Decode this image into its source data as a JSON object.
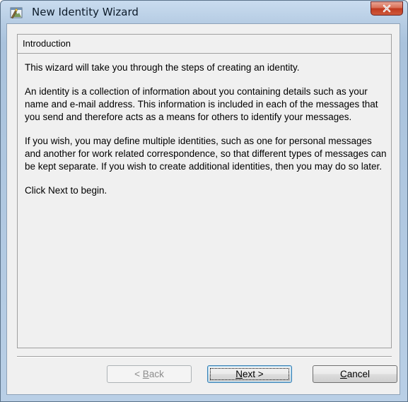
{
  "window": {
    "title": "New Identity Wizard",
    "app_icon": "identity-wizard-icon",
    "close_icon": "close-icon"
  },
  "page": {
    "heading": "Introduction",
    "paragraphs": [
      "This wizard will take you through the steps of creating an identity.",
      "An identity is a collection of information about you containing details such as your name and e-mail address.  This information is included in each of the messages that you send and therefore acts as a means for others to identify your messages.",
      "If you wish, you may define multiple identities, such as one for personal messages and another for work related correspondence, so that different types of messages can be kept separate.  If you wish to create additional identities, then you may do so later.",
      "Click Next to begin."
    ]
  },
  "buttons": {
    "back": {
      "prefix": "< ",
      "accel": "B",
      "rest": "ack",
      "enabled": false
    },
    "next": {
      "accel": "N",
      "rest": "ext >",
      "enabled": true,
      "default": true
    },
    "cancel": {
      "accel": "C",
      "rest": "ancel",
      "enabled": true
    }
  },
  "colors": {
    "frame": "#b7cde4",
    "client": "#f0f0f0",
    "close_button": "#c0391e",
    "default_button_border": "#3c7fb1"
  }
}
